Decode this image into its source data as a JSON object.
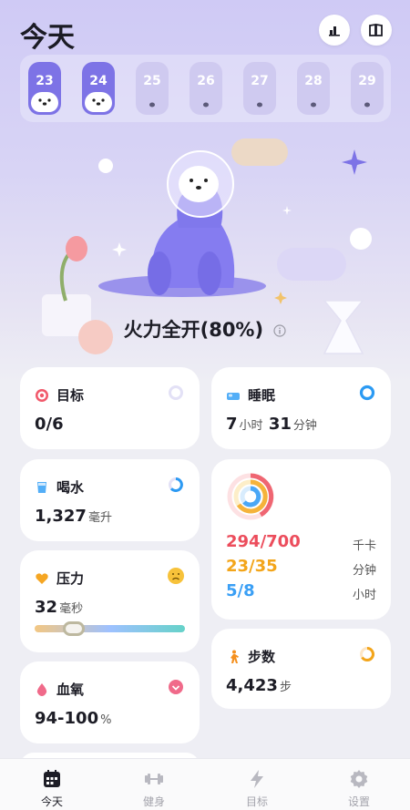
{
  "header": {
    "title": "今天"
  },
  "icons": {
    "stats": "bar-chart-icon",
    "journal": "book-icon"
  },
  "week": [
    {
      "label": "23",
      "active": true
    },
    {
      "label": "24",
      "active": true
    },
    {
      "label": "25",
      "active": false
    },
    {
      "label": "26",
      "active": false
    },
    {
      "label": "27",
      "active": false
    },
    {
      "label": "28",
      "active": false
    },
    {
      "label": "29",
      "active": false
    }
  ],
  "hero": {
    "status": "火力全开(80%)"
  },
  "cards": {
    "goal": {
      "title": "目标",
      "value": "0/6"
    },
    "sleep": {
      "title": "睡眠",
      "hours": "7",
      "hours_unit": "小时",
      "minutes": "31",
      "minutes_unit": "分钟"
    },
    "water": {
      "title": "喝水",
      "value": "1,327",
      "unit": "毫升"
    },
    "activity": {
      "calories": "294/700",
      "calories_unit": "千卡",
      "exercise": "23/35",
      "exercise_unit": "分钟",
      "stand": "5/8",
      "stand_unit": "小时"
    },
    "stress": {
      "title": "压力",
      "value": "32",
      "unit": "毫秒",
      "level": 0.22
    },
    "steps": {
      "title": "步数",
      "value": "4,423",
      "unit": "步"
    },
    "spo2": {
      "title": "血氧",
      "value": "94-100",
      "unit": "%"
    }
  },
  "tabs": [
    {
      "label": "今天",
      "active": true
    },
    {
      "label": "健身",
      "active": false
    },
    {
      "label": "目标",
      "active": false
    },
    {
      "label": "设置",
      "active": false
    }
  ],
  "colors": {
    "accent": "#7d73e6",
    "calories": "#ec4d5c",
    "exercise": "#f3a51a",
    "stand": "#3a9ff5"
  }
}
